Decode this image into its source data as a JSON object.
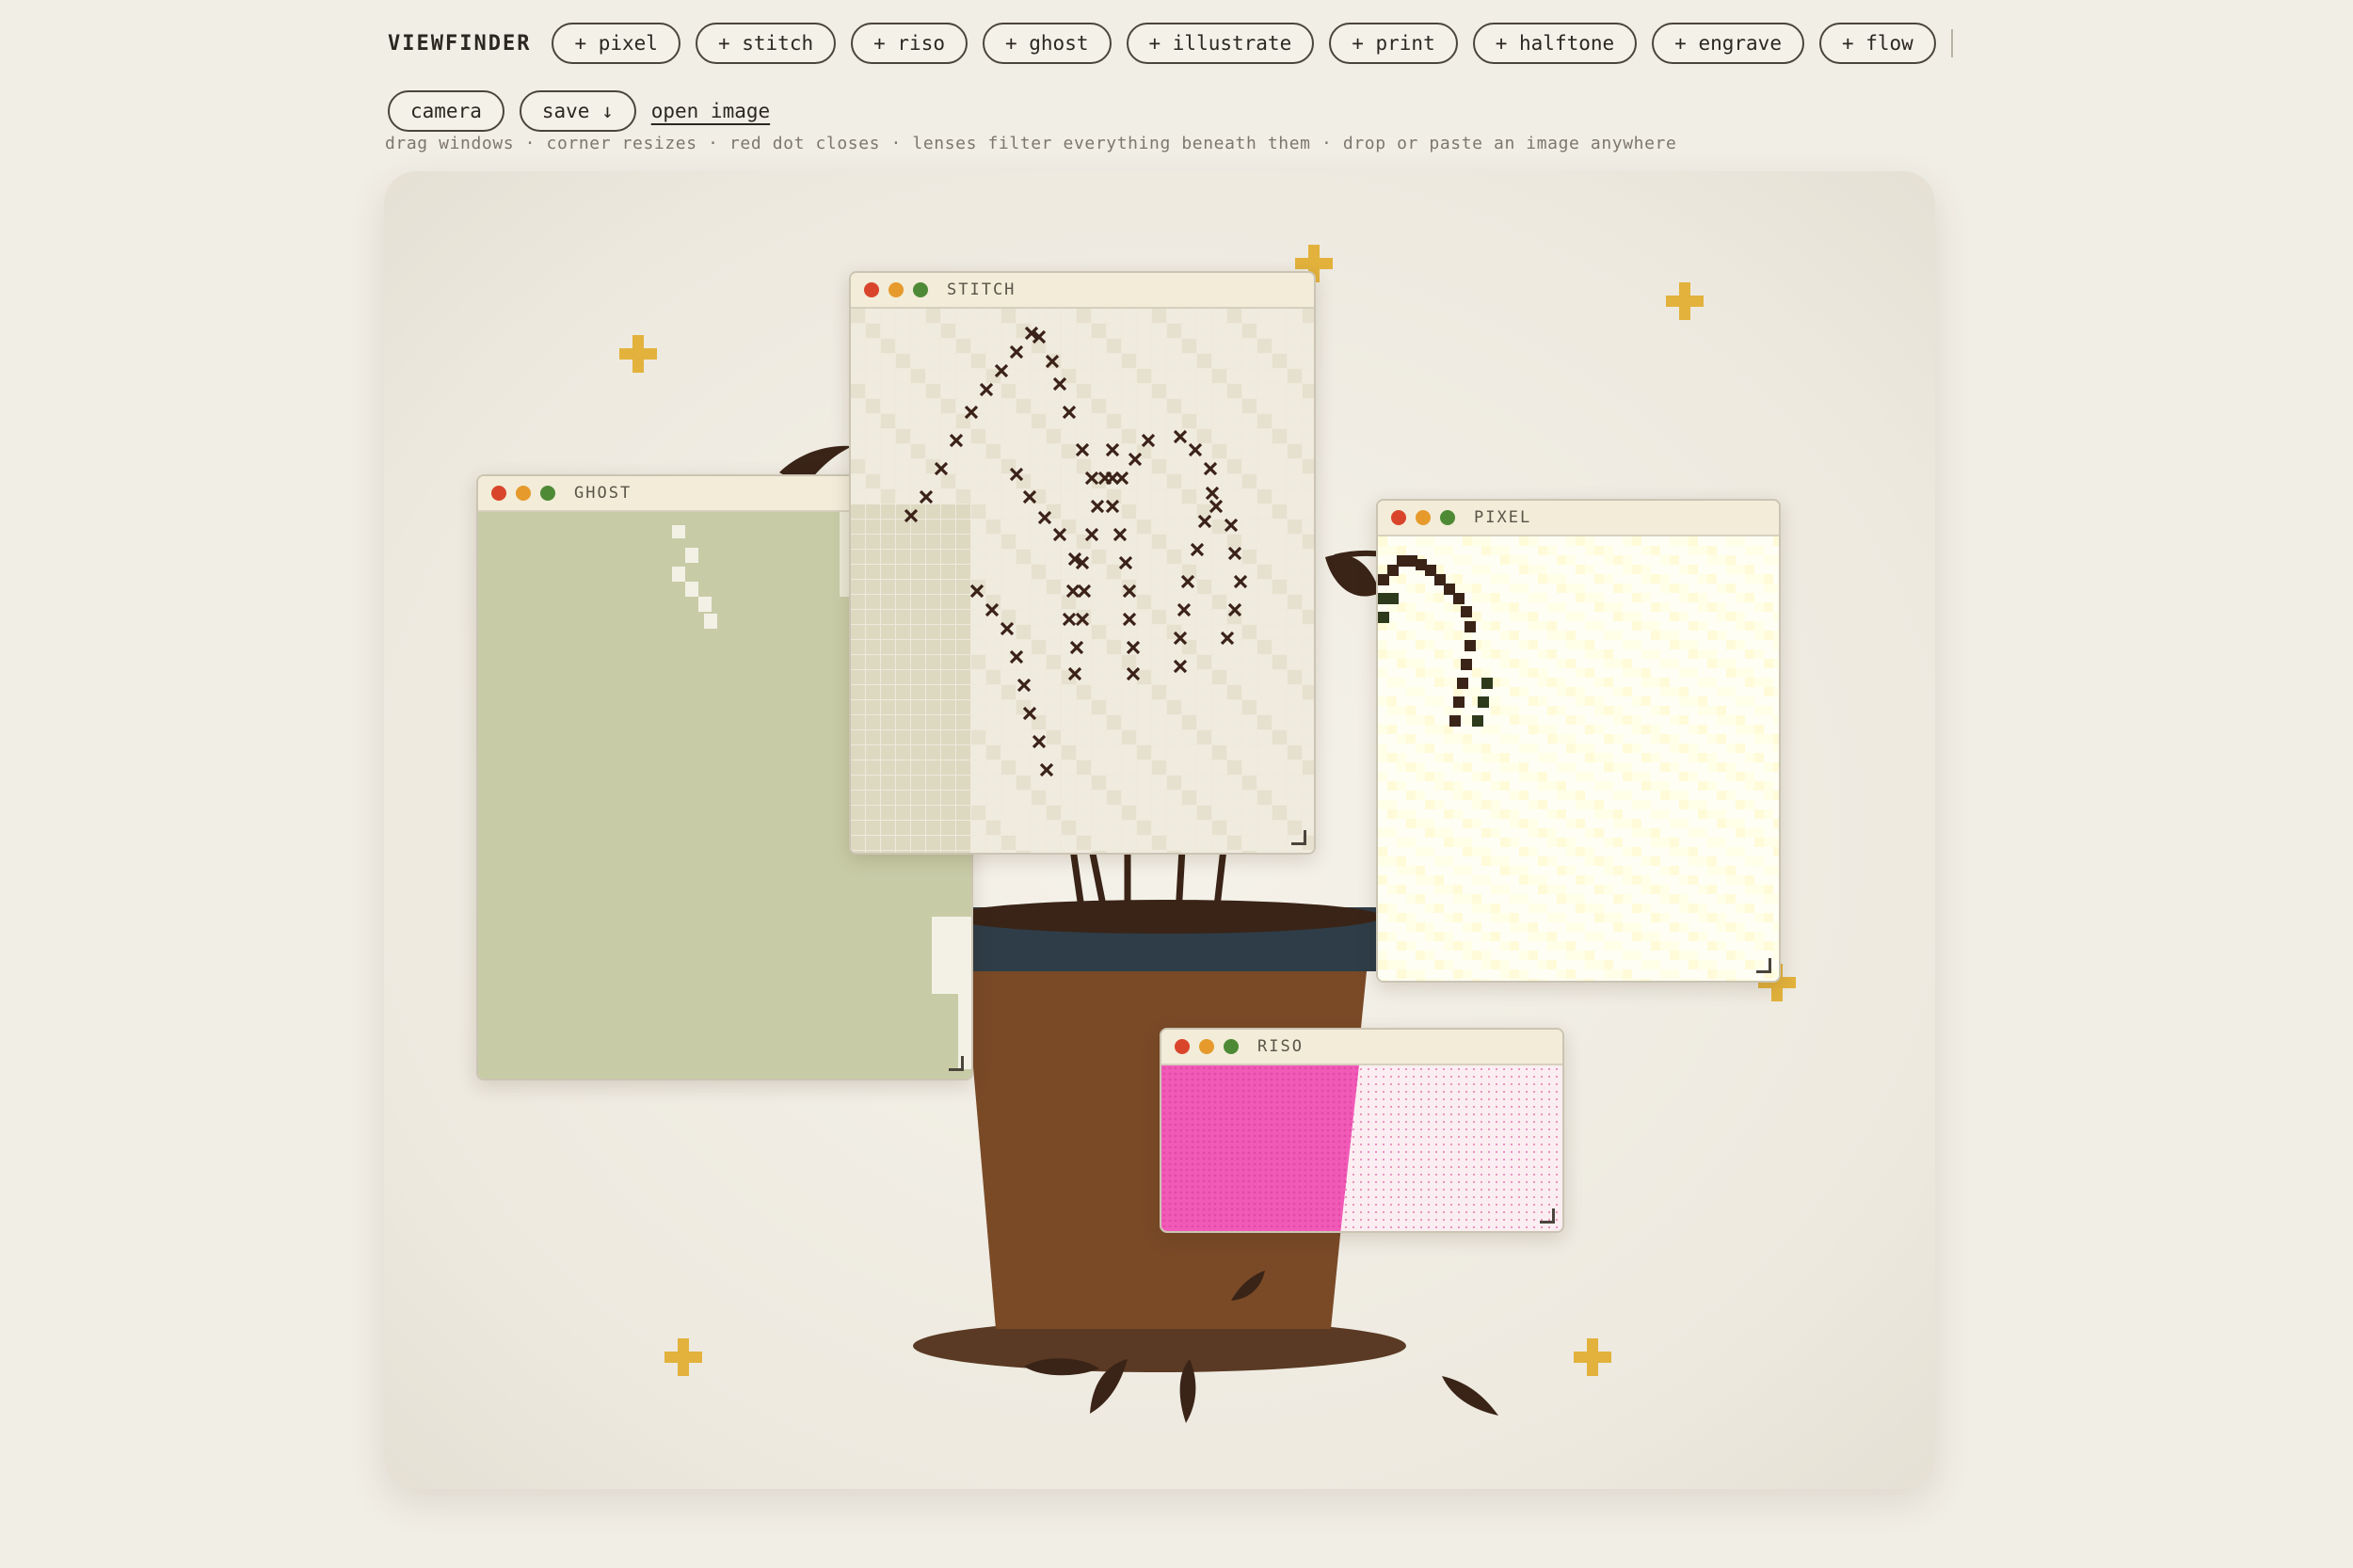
{
  "toolbar": {
    "brand": "VIEWFINDER",
    "lens_buttons": [
      "+ pixel",
      "+ stitch",
      "+ riso",
      "+ ghost",
      "+ illustrate",
      "+ print",
      "+ halftone",
      "+ engrave",
      "+ flow"
    ],
    "camera_label": "camera",
    "save_label": "save ↓",
    "open_label": "open image"
  },
  "hint": "drag windows · corner resizes · red dot closes · lenses filter everything beneath them · drop or paste an image anywhere",
  "windows": {
    "ghost": {
      "title": "GHOST"
    },
    "stitch": {
      "title": "STITCH"
    },
    "pixel": {
      "title": "PIXEL"
    },
    "riso": {
      "title": "RISO"
    }
  },
  "colors": {
    "background": "#f1eee6",
    "sparkle": "#e2b23c",
    "pot": "#7a4a27",
    "pot_rim": "#2e3d48",
    "ghost_tint": "#c8cca6",
    "riso_pink": "#f25ab8",
    "stitch_thread": "#3b2219",
    "close_dot": "#d9452b",
    "min_dot": "#e69a2c",
    "max_dot": "#4e8a36"
  },
  "icons": [
    "sparkle-icon",
    "close-dot-icon",
    "minimize-dot-icon",
    "maximize-dot-icon",
    "resize-handle-icon",
    "download-arrow-icon"
  ]
}
